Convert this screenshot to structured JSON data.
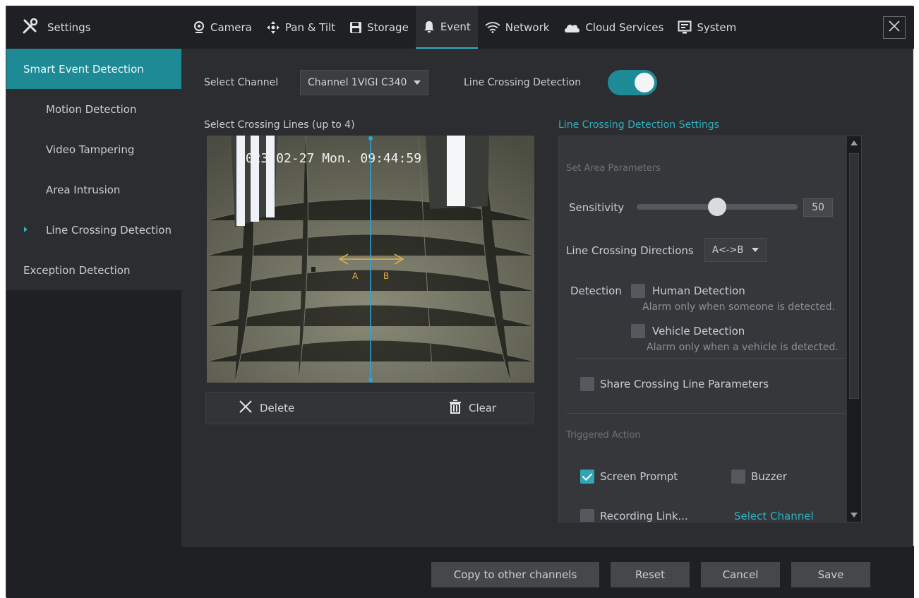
{
  "app": {
    "title": "Settings",
    "icon": "tools-icon"
  },
  "tabs": [
    {
      "label": "Camera",
      "icon": "camera-icon"
    },
    {
      "label": "Pan & Tilt",
      "icon": "pan-tilt-icon"
    },
    {
      "label": "Storage",
      "icon": "storage-icon"
    },
    {
      "label": "Event",
      "icon": "bell-icon",
      "active": true
    },
    {
      "label": "Network",
      "icon": "wifi-icon"
    },
    {
      "label": "Cloud Services",
      "icon": "cloud-icon"
    },
    {
      "label": "System",
      "icon": "monitor-icon"
    }
  ],
  "sidebar": {
    "items": [
      {
        "label": "Smart Event Detection",
        "active": true
      },
      {
        "label": "Motion Detection"
      },
      {
        "label": "Video Tampering"
      },
      {
        "label": "Area Intrusion"
      },
      {
        "label": "Line Crossing Detection",
        "current": true
      },
      {
        "label": "Exception Detection"
      }
    ]
  },
  "main": {
    "select_channel_label": "Select Channel",
    "channel_value": "Channel 1VIGI C340",
    "line_crossing_label": "Line Crossing Detection",
    "line_crossing_enabled": true,
    "crossing_lines_label": "Select Crossing Lines (up to 4)",
    "video": {
      "timestamp": "2023-02-27 Mon. 09:44:59",
      "point_a": "A",
      "point_b": "B"
    },
    "delete_label": "Delete",
    "clear_label": "Clear"
  },
  "settings": {
    "title": "Line Crossing Detection Settings",
    "area_params_label": "Set Area Parameters",
    "sensitivity_label": "Sensitivity",
    "sensitivity_value": "50",
    "sensitivity_fraction": 0.5,
    "directions_label": "Line Crossing Directions",
    "directions_value": "A<->B",
    "detection_label": "Detection",
    "human_label": "Human Detection",
    "human_hint": "Alarm only when someone is detected.",
    "vehicle_label": "Vehicle Detection",
    "vehicle_hint": "Alarm only when a vehicle is detected.",
    "share_label": "Share Crossing Line Parameters",
    "triggered_label": "Triggered Action",
    "screen_prompt_label": "Screen Prompt",
    "screen_prompt_checked": true,
    "buzzer_label": "Buzzer",
    "recording_label": "Recording Link...",
    "select_channel_link": "Select Channel"
  },
  "footer": {
    "copy_label": "Copy to other channels",
    "reset_label": "Reset",
    "cancel_label": "Cancel",
    "save_label": "Save"
  },
  "colors": {
    "accent": "#2fb0c0",
    "accent_dark": "#1e8a96",
    "bg": "#2b2d30",
    "bar": "#1f2023"
  }
}
